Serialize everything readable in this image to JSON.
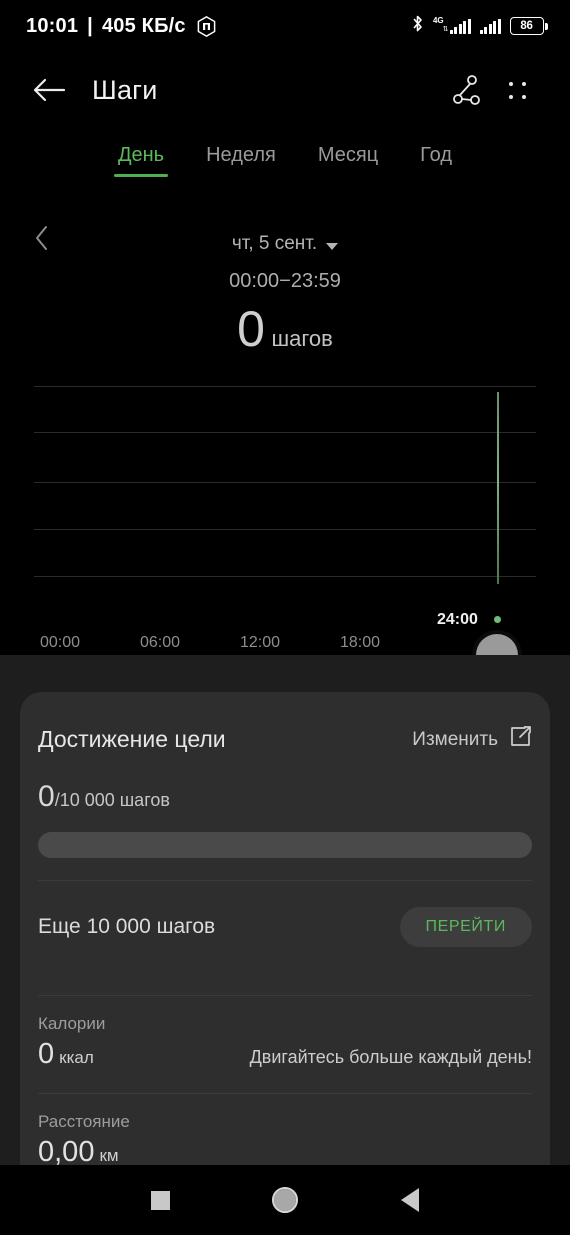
{
  "status_bar": {
    "time": "10:01",
    "separator": "|",
    "network_speed": "405 КБ/с",
    "mi_icon": "mi-logo-icon",
    "bluetooth_icon": "bluetooth-icon",
    "network_type": "4G",
    "battery_level": "86"
  },
  "header": {
    "back_icon": "arrow-left-icon",
    "title": "Шаги",
    "share_icon": "share-nodes-icon",
    "menu_icon": "four-dots-menu-icon"
  },
  "tabs": [
    {
      "label": "День",
      "active": true
    },
    {
      "label": "Неделя",
      "active": false
    },
    {
      "label": "Месяц",
      "active": false
    },
    {
      "label": "Год",
      "active": false
    }
  ],
  "summary": {
    "prev_icon": "chevron-left-icon",
    "date": "чт, 5 сент.",
    "dropdown_icon": "caret-down-icon",
    "time_range": "00:00−23:59",
    "total_value": "0",
    "total_unit": "шагов"
  },
  "chart_data": {
    "type": "bar",
    "title": "Шаги за день",
    "xlabel": "",
    "ylabel": "",
    "categories": [
      "00:00",
      "06:00",
      "12:00",
      "18:00"
    ],
    "tick_labels": [
      "00:00",
      "06:00",
      "12:00",
      "18:00"
    ],
    "values": [
      0,
      0,
      0,
      0
    ],
    "x": [],
    "xlim": [
      "00:00",
      "24:00"
    ],
    "ylim": [
      0,
      0
    ],
    "grid": true,
    "gridline_count": 5,
    "legend": "none",
    "cursor_label": "24:00",
    "cursor_position": "24:00",
    "cursor_value": "0",
    "accent_color": "#6fbd78",
    "gridline_color": "#2b2b2b",
    "annotations": []
  },
  "goal_card": {
    "title": "Достижение цели",
    "edit_label": "Изменить",
    "edit_icon": "edit-square-icon",
    "current": "0",
    "target_text": "/10 000 шагов",
    "progress_percent": 0,
    "remaining_text": "Еще 10 000 шагов",
    "goto_button": "ПЕРЕЙТИ",
    "accent_color": "#5cb85c"
  },
  "metrics": [
    {
      "label": "Калории",
      "value": "0",
      "unit": "ккал",
      "tip": "Двигайтесь больше каждый день!"
    },
    {
      "label": "Расстояние",
      "value": "0,00",
      "unit": "км",
      "tip": ""
    }
  ],
  "nav_bar": {
    "recents_icon": "square-recents-icon",
    "home_icon": "circle-home-icon",
    "back_icon": "triangle-back-icon"
  }
}
